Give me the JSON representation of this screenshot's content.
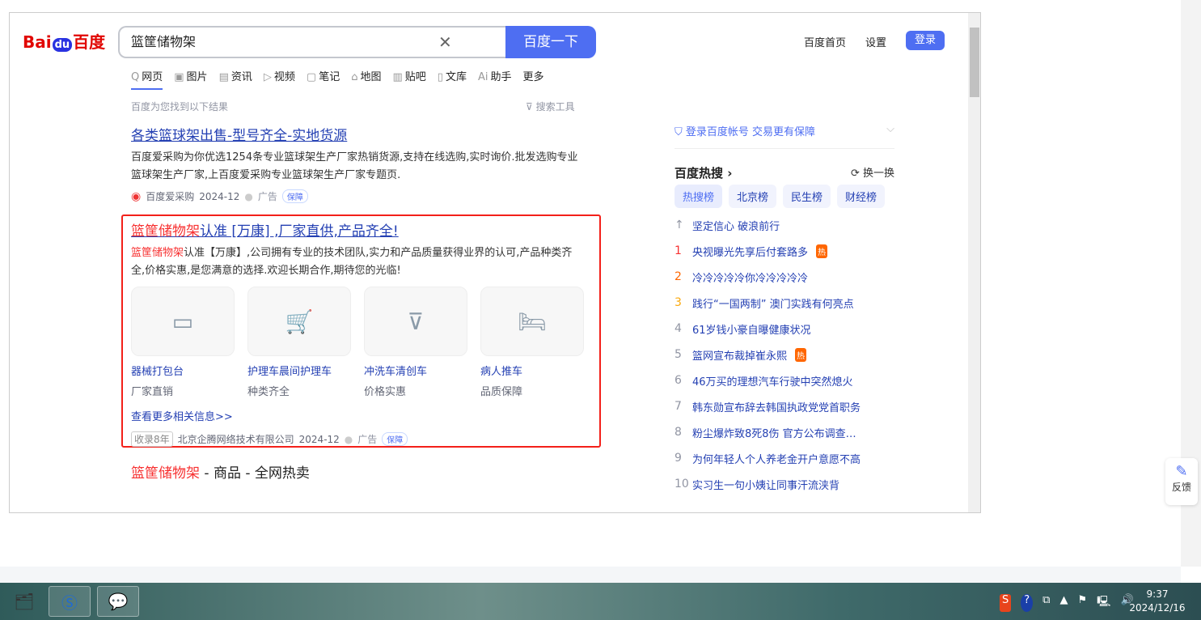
{
  "header": {
    "logo": "Bai du 百度",
    "query": "篮筐储物架",
    "search_button": "百度一下",
    "home": "百度首页",
    "settings": "设置",
    "login": "登录"
  },
  "tabs": [
    {
      "icon": "Q",
      "label": "网页"
    },
    {
      "icon": "▣",
      "label": "图片"
    },
    {
      "icon": "▤",
      "label": "资讯"
    },
    {
      "icon": "▷",
      "label": "视频"
    },
    {
      "icon": "▢",
      "label": "笔记"
    },
    {
      "icon": "⌂",
      "label": "地图"
    },
    {
      "icon": "▥",
      "label": "贴吧"
    },
    {
      "icon": "▯",
      "label": "文库"
    },
    {
      "icon": "Ai",
      "label": "助手"
    },
    {
      "icon": "",
      "label": "更多"
    }
  ],
  "meta": "百度为您找到以下结果",
  "tools": "搜索工具",
  "result1": {
    "title": "各类篮球架出售-型号齐全-实地货源",
    "desc": "百度爱采购为你优选1254条专业篮球架生产厂家热销货源,支持在线选购,实时询价.批发选购专业篮球架生产厂家,上百度爱采购专业篮球架生产厂家专题页.",
    "source": "百度爱采购",
    "date": "2024-12",
    "ad": "广告",
    "badge": "保障"
  },
  "result2": {
    "title_red": "篮筐储物架",
    "title_rest": "认准 [万康] ,厂家直供,产品齐全!",
    "desc_red": "篮筐储物架",
    "desc_rest": "认准【万康】,公司拥有专业的技术团队,实力和产品质量获得业界的认可,产品种类齐全,价格实惠,是您满意的选择.欢迎长期合作,期待您的光临!",
    "products": [
      {
        "name": "器械打包台",
        "sub": "厂家直销"
      },
      {
        "name": "护理车晨间护理车",
        "sub": "种类齐全"
      },
      {
        "name": "冲洗车清创车",
        "sub": "价格实惠"
      },
      {
        "name": "病人推车",
        "sub": "品质保障"
      }
    ],
    "more": "查看更多相关信息>>",
    "years": "收录8年",
    "source": "北京企腾网络技术有限公司",
    "date": "2024-12",
    "ad": "广告",
    "badge": "保障"
  },
  "result3": {
    "title_red": "篮筐储物架",
    "title_rest": " - 商品 - 全网热卖"
  },
  "sidebar": {
    "login_tip": "登录百度帐号 交易更有保障",
    "hot_title": "百度热搜",
    "refresh": "换一换",
    "pills": [
      "热搜榜",
      "北京榜",
      "民生榜",
      "财经榜"
    ],
    "top": "坚定信心 破浪前行",
    "items": [
      {
        "n": "1",
        "t": "央视曝光先享后付套路多",
        "hot": "热"
      },
      {
        "n": "2",
        "t": "冷冷冷冷冷你冷冷冷冷冷"
      },
      {
        "n": "3",
        "t": "践行“一国两制” 澳门实践有何亮点"
      },
      {
        "n": "4",
        "t": "61岁钱小豪自曝健康状况"
      },
      {
        "n": "5",
        "t": "篮网宣布裁掉崔永熙",
        "hot": "热"
      },
      {
        "n": "6",
        "t": "46万买的理想汽车行驶中突然熄火"
      },
      {
        "n": "7",
        "t": "韩东勋宣布辞去韩国执政党党首职务"
      },
      {
        "n": "8",
        "t": "粉尘爆炸致8死8伤 官方公布调查…"
      },
      {
        "n": "9",
        "t": "为何年轻人个人养老金开户意愿不高"
      },
      {
        "n": "10",
        "t": "实习生一句小姨让同事汗流浃背"
      }
    ]
  },
  "feedback": "反馈",
  "taskbar": {
    "time": "9:37",
    "date": "2024/12/16"
  },
  "colors": {
    "accent": "#4e6ef2",
    "link": "#2440b3",
    "red": "#f73131"
  }
}
